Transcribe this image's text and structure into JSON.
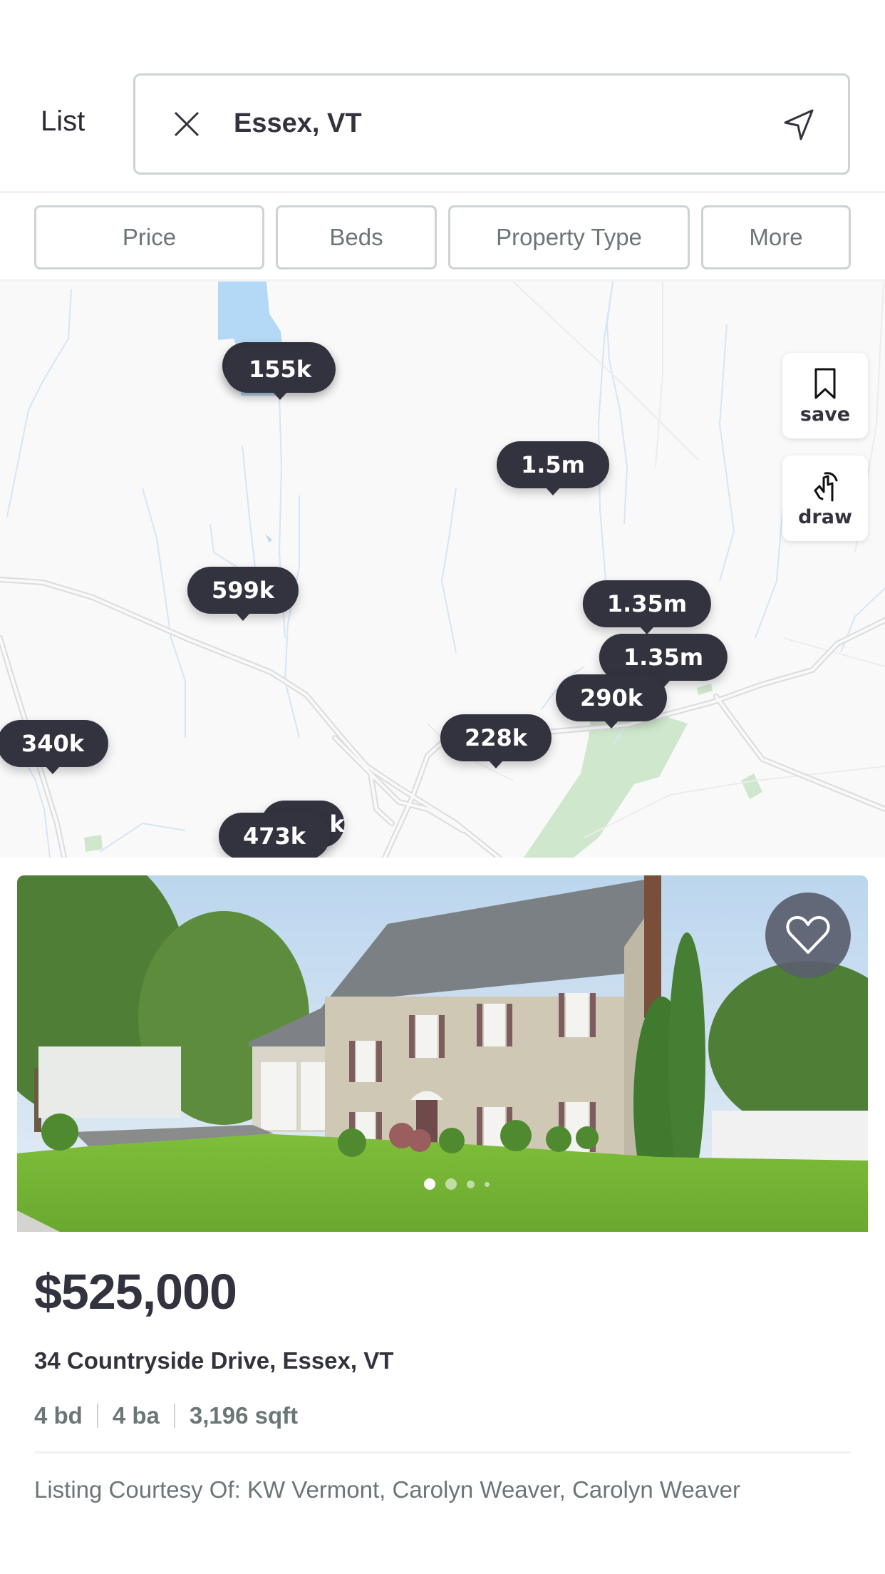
{
  "header": {
    "list_label": "List",
    "search": {
      "value": "Essex, VT",
      "clear_icon": "close-icon",
      "locate_icon": "navigation-arrow-icon"
    }
  },
  "filters": [
    {
      "label": "Price"
    },
    {
      "label": "Beds"
    },
    {
      "label": "Property Type"
    },
    {
      "label": "More"
    }
  ],
  "map": {
    "markers": [
      {
        "label": "155k",
        "stacked": true
      },
      {
        "label": "1.5m"
      },
      {
        "label": "599k"
      },
      {
        "label": "1.35m"
      },
      {
        "label": "1.35m"
      },
      {
        "label": "290k"
      },
      {
        "label": "340k"
      },
      {
        "label": "228k"
      },
      {
        "label": "k",
        "partially_hidden": true
      },
      {
        "label": "473k"
      }
    ],
    "tools": {
      "save": {
        "label": "save",
        "icon": "bookmark-icon"
      },
      "draw": {
        "label": "draw",
        "icon": "hand-draw-icon"
      }
    }
  },
  "listing": {
    "price": "$525,000",
    "address": "34 Countryside Drive, Essex, VT",
    "beds": "4 bd",
    "baths": "4 ba",
    "sqft": "3,196 sqft",
    "courtesy": "Listing Courtesy Of: KW Vermont, Carolyn Weaver, Carolyn Weaver",
    "favorite_icon": "heart-outline-icon",
    "photo_count_dots": 4,
    "active_photo_index": 0
  },
  "colors": {
    "marker": "#33333f",
    "text_primary": "#33333f",
    "text_secondary": "#6b7677",
    "border": "#cdd3d4",
    "water": "#b3d9f7",
    "park": "#cfe8cd"
  }
}
